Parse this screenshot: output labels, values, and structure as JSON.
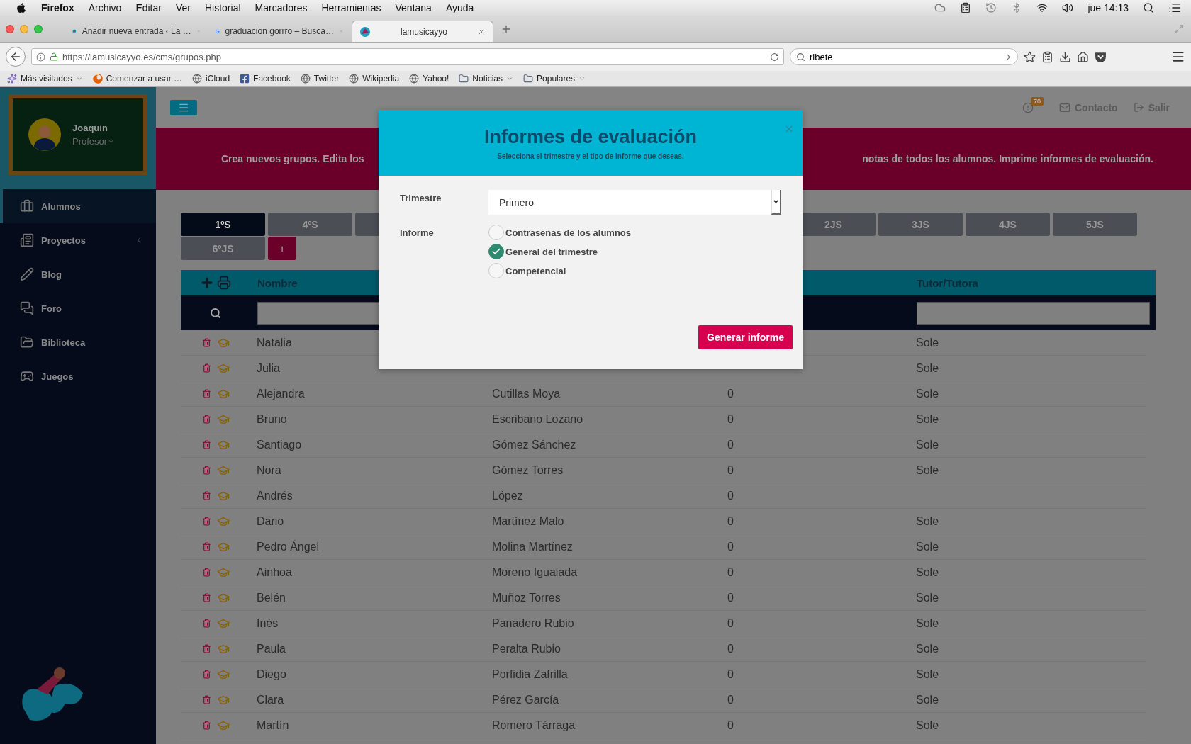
{
  "menu_bar": {
    "app": "Firefox",
    "menus": [
      "Archivo",
      "Editar",
      "Ver",
      "Historial",
      "Marcadores",
      "Herramientas",
      "Ventana",
      "Ayuda"
    ],
    "clock": "jue 14:13"
  },
  "browser_tabs": [
    {
      "title": "Añadir nueva entrada ‹ La …",
      "selected": false,
      "kind": "site"
    },
    {
      "title": "graduacion gorrro – Busca…",
      "selected": false,
      "kind": "google"
    },
    {
      "title": "lamusicayyo",
      "selected": true,
      "kind": "site"
    }
  ],
  "address_bar": {
    "url": "https://lamusicayyo.es/cms/grupos.php"
  },
  "search_box": {
    "value": "ribete"
  },
  "bookmarks": [
    {
      "label": "Más visitados",
      "kind": "smart"
    },
    {
      "label": "Comenzar a usar …",
      "kind": "firefox"
    },
    {
      "label": "iCloud",
      "kind": "site"
    },
    {
      "label": "Facebook",
      "kind": "facebook"
    },
    {
      "label": "Twitter",
      "kind": "site"
    },
    {
      "label": "Wikipedia",
      "kind": "site"
    },
    {
      "label": "Yahoo!",
      "kind": "site"
    },
    {
      "label": "Noticias",
      "kind": "folder"
    },
    {
      "label": "Populares",
      "kind": "folder"
    }
  ],
  "profile": {
    "name": "Joaquin",
    "role": "Profesor"
  },
  "sidebar": {
    "items": [
      {
        "label": "Alumnos",
        "selected": true,
        "kind": "link"
      },
      {
        "label": "Proyectos",
        "selected": false,
        "kind": "submenu"
      },
      {
        "label": "Blog",
        "selected": false,
        "kind": "link"
      },
      {
        "label": "Foro",
        "selected": false,
        "kind": "link"
      },
      {
        "label": "Biblioteca",
        "selected": false,
        "kind": "link"
      },
      {
        "label": "Juegos",
        "selected": false,
        "kind": "link"
      }
    ]
  },
  "top_nav": {
    "notifications": "70",
    "links": [
      "Contacto",
      "Salir"
    ]
  },
  "banner": {
    "text_left": "Crea nuevos grupos. Edita los",
    "text_right": "notas de todos los alumnos. Imprime informes de evaluación."
  },
  "group_tabs": [
    {
      "label": "1ºS",
      "selected": true
    },
    {
      "label": "4ºS",
      "selected": false
    },
    {
      "selected": false
    },
    {
      "label": "2JS",
      "selected": false
    },
    {
      "label": "3JS",
      "selected": false
    },
    {
      "label": "4JS",
      "selected": false
    },
    {
      "label": "5JS",
      "selected": false
    },
    {
      "label": "6ºJS",
      "selected": false
    }
  ],
  "add_group": "+",
  "table": {
    "header": {
      "nombre": "Nombre",
      "tutor": "Tutor/Tutora"
    },
    "rows": [
      {
        "nombre": "Natalia",
        "tutor": "Sole"
      },
      {
        "nombre": "Julia",
        "tutor": "Sole"
      },
      {
        "nombre": "Alejandra",
        "column_2": "Cutillas Moya",
        "column_3": "0",
        "tutor": "Sole"
      },
      {
        "nombre": "Bruno",
        "column_2": "Escribano Lozano",
        "column_3": "0",
        "tutor": "Sole"
      },
      {
        "nombre": "Santiago",
        "column_2": "Gómez Sánchez",
        "column_3": "0",
        "tutor": "Sole"
      },
      {
        "nombre": "Nora",
        "column_2": "Gómez Torres",
        "column_3": "0",
        "tutor": "Sole"
      },
      {
        "nombre": "Andrés",
        "column_2": "López",
        "column_3": "0"
      },
      {
        "nombre": "Dario",
        "column_2": "Martínez Malo",
        "column_3": "0",
        "tutor": "Sole"
      },
      {
        "nombre": "Pedro Ángel",
        "column_2": "Molina Martínez",
        "column_3": "0",
        "tutor": "Sole"
      },
      {
        "nombre": "Ainhoa",
        "column_2": "Moreno Igualada",
        "column_3": "0",
        "tutor": "Sole"
      },
      {
        "nombre": "Belén",
        "column_2": "Muñoz Torres",
        "column_3": "0",
        "tutor": "Sole"
      },
      {
        "nombre": "Inés",
        "column_2": "Panadero Rubio",
        "column_3": "0",
        "tutor": "Sole"
      },
      {
        "nombre": "Paula",
        "column_2": "Peralta Rubio",
        "column_3": "0",
        "tutor": "Sole"
      },
      {
        "nombre": "Diego",
        "column_2": "Porfidia Zafrilla",
        "column_3": "0",
        "tutor": "Sole"
      },
      {
        "nombre": "Clara",
        "column_2": "Pérez García",
        "column_3": "0",
        "tutor": "Sole"
      },
      {
        "nombre": "Martín",
        "column_2": "Romero Tárraga",
        "column_3": "0",
        "tutor": "Sole"
      }
    ]
  },
  "modal": {
    "title": "Informes de evaluación",
    "subtitle": "Selecciona el trimestre y el tipo de informe que deseas.",
    "trimestre_label": "Trimestre",
    "trimestre_value": "Primero",
    "informe_label": "Informe",
    "options": [
      {
        "label": "Contraseñas de los alumnos",
        "selected": false
      },
      {
        "label": "General del trimestre",
        "selected": true
      },
      {
        "label": "Competencial",
        "selected": false
      }
    ],
    "button": "Generar informe"
  }
}
